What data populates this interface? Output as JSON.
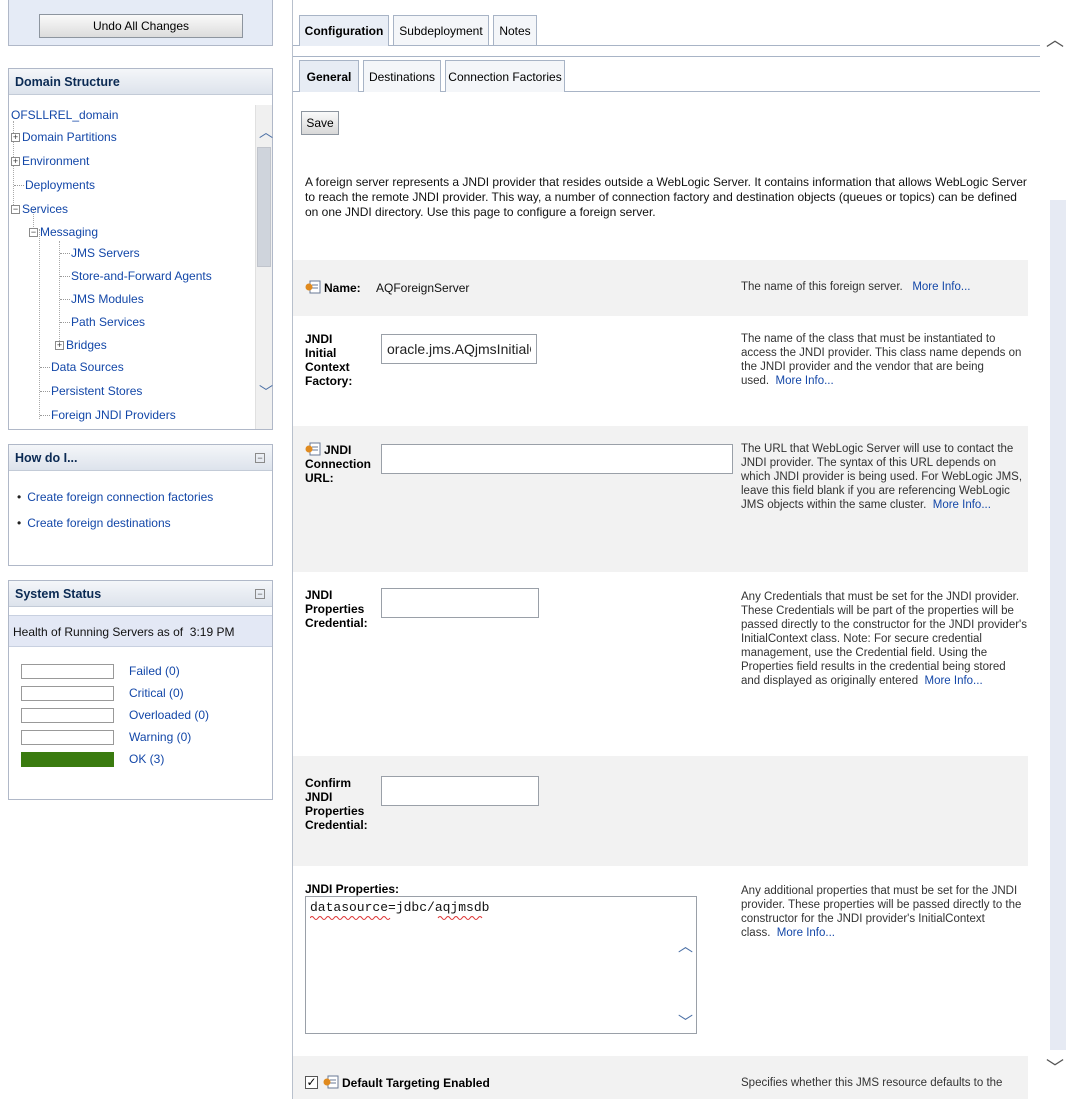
{
  "left": {
    "undo_button": "Undo All Changes",
    "domain_structure": {
      "title": "Domain Structure",
      "items": [
        {
          "label": "OFSLLREL_domain"
        },
        {
          "label": "Domain Partitions"
        },
        {
          "label": "Environment"
        },
        {
          "label": "Deployments"
        },
        {
          "label": "Services"
        },
        {
          "label": "Messaging"
        },
        {
          "label": "JMS Servers"
        },
        {
          "label": "Store-and-Forward Agents"
        },
        {
          "label": "JMS Modules"
        },
        {
          "label": "Path Services"
        },
        {
          "label": "Bridges"
        },
        {
          "label": "Data Sources"
        },
        {
          "label": "Persistent Stores"
        },
        {
          "label": "Foreign JNDI Providers"
        }
      ]
    },
    "how_do_i": {
      "title": "How do I...",
      "links": [
        "Create foreign connection factories",
        "Create foreign destinations"
      ]
    },
    "system_status": {
      "title": "System Status",
      "health_prefix": "Health of Running Servers as of",
      "health_time": "3:19 PM",
      "rows": [
        {
          "label": "Failed (0)",
          "fill": 0
        },
        {
          "label": "Critical (0)",
          "fill": 0
        },
        {
          "label": "Overloaded (0)",
          "fill": 0
        },
        {
          "label": "Warning (0)",
          "fill": 0
        },
        {
          "label": "OK (3)",
          "fill": 1.0,
          "color": "#3a7b0f"
        }
      ]
    }
  },
  "main": {
    "tabs": [
      "Configuration",
      "Subdeployment",
      "Notes"
    ],
    "active_tab": "Configuration",
    "subtabs": [
      "General",
      "Destinations",
      "Connection Factories"
    ],
    "active_subtab": "General",
    "save_label": "Save",
    "intro": "A foreign server represents a JNDI provider that resides outside a WebLogic Server. It contains information that allows WebLogic Server to reach the remote JNDI provider. This way, a number of connection factory and destination objects (queues or topics) can be defined on one JNDI directory. Use this page to configure a foreign server.",
    "more_info": "More Info...",
    "fields": {
      "name": {
        "label": "Name:",
        "value": "AQForeignServer",
        "help": "The name of this foreign server."
      },
      "jndi_initial_context_factory": {
        "label_lines": [
          "JNDI",
          "Initial",
          "Context",
          "Factory:"
        ],
        "value": "oracle.jms.AQjmsInitialC(",
        "help": "The name of the class that must be instantiated to access the JNDI provider. This class name depends on the JNDI provider and the vendor that are being used."
      },
      "jndi_connection_url": {
        "label_lines": [
          "JNDI",
          "Connection",
          "URL:"
        ],
        "value": "",
        "help": "The URL that WebLogic Server will use to contact the JNDI provider. The syntax of this URL depends on which JNDI provider is being used. For WebLogic JMS, leave this field blank if you are referencing WebLogic JMS objects within the same cluster."
      },
      "jndi_properties_credential": {
        "label_lines": [
          "JNDI",
          "Properties",
          "Credential:"
        ],
        "value": "",
        "help": "Any Credentials that must be set for the JNDI provider. These Credentials will be part of the properties will be passed directly to the constructor for the JNDI provider's InitialContext class. Note: For secure credential management, use the Credential field. Using the Properties field results in the credential being stored and displayed as originally entered"
      },
      "confirm_jndi_properties_credential": {
        "label_lines": [
          "Confirm",
          "JNDI",
          "Properties",
          "Credential:"
        ],
        "value": ""
      },
      "jndi_properties": {
        "label": "JNDI Properties:",
        "value": "datasource=jdbc/aqjmsdb",
        "help": "Any additional properties that must be set for the JNDI provider. These properties will be passed directly to the constructor for the JNDI provider's InitialContext class."
      },
      "default_targeting": {
        "label": "Default Targeting Enabled",
        "checked": true,
        "help": "Specifies whether this JMS resource defaults to the"
      }
    }
  },
  "colors": {
    "link": "#1347a8",
    "panel_header": "#0b2a53",
    "ok_green": "#3a7b0f",
    "row_shade": "#f2f2f2"
  }
}
